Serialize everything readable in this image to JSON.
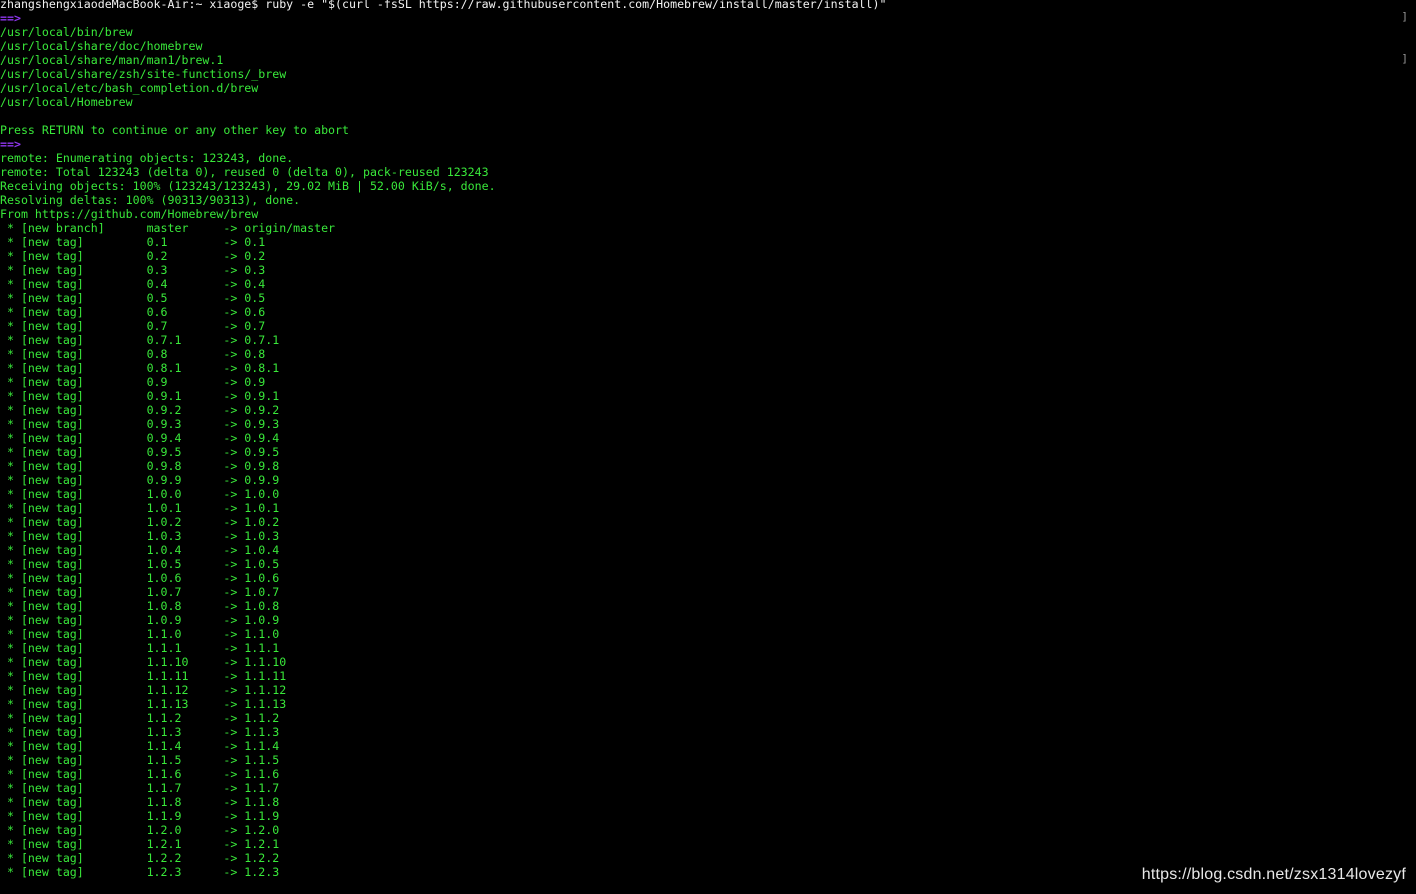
{
  "terminal": {
    "lines": [
      {
        "type": "prompt",
        "text": "zhangshengxiaodeMacBook-Air:~ xiaoge$ ruby -e \"$(curl -fsSL https://raw.githubusercontent.com/Homebrew/install/master/install)\""
      },
      {
        "type": "arrow",
        "text": "==>"
      },
      {
        "type": "info",
        "text": "/usr/local/bin/brew"
      },
      {
        "type": "info",
        "text": "/usr/local/share/doc/homebrew"
      },
      {
        "type": "info",
        "text": "/usr/local/share/man/man1/brew.1"
      },
      {
        "type": "info",
        "text": "/usr/local/share/zsh/site-functions/_brew"
      },
      {
        "type": "info",
        "text": "/usr/local/etc/bash_completion.d/brew"
      },
      {
        "type": "info",
        "text": "/usr/local/Homebrew"
      },
      {
        "type": "blank",
        "text": ""
      },
      {
        "type": "info",
        "text": "Press RETURN to continue or any other key to abort"
      },
      {
        "type": "arrow",
        "text": "==>"
      },
      {
        "type": "info",
        "text": "remote: Enumerating objects: 123243, done."
      },
      {
        "type": "info",
        "text": "remote: Total 123243 (delta 0), reused 0 (delta 0), pack-reused 123243"
      },
      {
        "type": "info",
        "text": "Receiving objects: 100% (123243/123243), 29.02 MiB | 52.00 KiB/s, done."
      },
      {
        "type": "info",
        "text": "Resolving deltas: 100% (90313/90313), done."
      },
      {
        "type": "info",
        "text": "From https://github.com/Homebrew/brew"
      },
      {
        "type": "info",
        "text": " * [new branch]      master     -> origin/master"
      },
      {
        "type": "info",
        "text": " * [new tag]         0.1        -> 0.1"
      },
      {
        "type": "info",
        "text": " * [new tag]         0.2        -> 0.2"
      },
      {
        "type": "info",
        "text": " * [new tag]         0.3        -> 0.3"
      },
      {
        "type": "info",
        "text": " * [new tag]         0.4        -> 0.4"
      },
      {
        "type": "info",
        "text": " * [new tag]         0.5        -> 0.5"
      },
      {
        "type": "info",
        "text": " * [new tag]         0.6        -> 0.6"
      },
      {
        "type": "info",
        "text": " * [new tag]         0.7        -> 0.7"
      },
      {
        "type": "info",
        "text": " * [new tag]         0.7.1      -> 0.7.1"
      },
      {
        "type": "info",
        "text": " * [new tag]         0.8        -> 0.8"
      },
      {
        "type": "info",
        "text": " * [new tag]         0.8.1      -> 0.8.1"
      },
      {
        "type": "info",
        "text": " * [new tag]         0.9        -> 0.9"
      },
      {
        "type": "info",
        "text": " * [new tag]         0.9.1      -> 0.9.1"
      },
      {
        "type": "info",
        "text": " * [new tag]         0.9.2      -> 0.9.2"
      },
      {
        "type": "info",
        "text": " * [new tag]         0.9.3      -> 0.9.3"
      },
      {
        "type": "info",
        "text": " * [new tag]         0.9.4      -> 0.9.4"
      },
      {
        "type": "info",
        "text": " * [new tag]         0.9.5      -> 0.9.5"
      },
      {
        "type": "info",
        "text": " * [new tag]         0.9.8      -> 0.9.8"
      },
      {
        "type": "info",
        "text": " * [new tag]         0.9.9      -> 0.9.9"
      },
      {
        "type": "info",
        "text": " * [new tag]         1.0.0      -> 1.0.0"
      },
      {
        "type": "info",
        "text": " * [new tag]         1.0.1      -> 1.0.1"
      },
      {
        "type": "info",
        "text": " * [new tag]         1.0.2      -> 1.0.2"
      },
      {
        "type": "info",
        "text": " * [new tag]         1.0.3      -> 1.0.3"
      },
      {
        "type": "info",
        "text": " * [new tag]         1.0.4      -> 1.0.4"
      },
      {
        "type": "info",
        "text": " * [new tag]         1.0.5      -> 1.0.5"
      },
      {
        "type": "info",
        "text": " * [new tag]         1.0.6      -> 1.0.6"
      },
      {
        "type": "info",
        "text": " * [new tag]         1.0.7      -> 1.0.7"
      },
      {
        "type": "info",
        "text": " * [new tag]         1.0.8      -> 1.0.8"
      },
      {
        "type": "info",
        "text": " * [new tag]         1.0.9      -> 1.0.9"
      },
      {
        "type": "info",
        "text": " * [new tag]         1.1.0      -> 1.1.0"
      },
      {
        "type": "info",
        "text": " * [new tag]         1.1.1      -> 1.1.1"
      },
      {
        "type": "info",
        "text": " * [new tag]         1.1.10     -> 1.1.10"
      },
      {
        "type": "info",
        "text": " * [new tag]         1.1.11     -> 1.1.11"
      },
      {
        "type": "info",
        "text": " * [new tag]         1.1.12     -> 1.1.12"
      },
      {
        "type": "info",
        "text": " * [new tag]         1.1.13     -> 1.1.13"
      },
      {
        "type": "info",
        "text": " * [new tag]         1.1.2      -> 1.1.2"
      },
      {
        "type": "info",
        "text": " * [new tag]         1.1.3      -> 1.1.3"
      },
      {
        "type": "info",
        "text": " * [new tag]         1.1.4      -> 1.1.4"
      },
      {
        "type": "info",
        "text": " * [new tag]         1.1.5      -> 1.1.5"
      },
      {
        "type": "info",
        "text": " * [new tag]         1.1.6      -> 1.1.6"
      },
      {
        "type": "info",
        "text": " * [new tag]         1.1.7      -> 1.1.7"
      },
      {
        "type": "info",
        "text": " * [new tag]         1.1.8      -> 1.1.8"
      },
      {
        "type": "info",
        "text": " * [new tag]         1.1.9      -> 1.1.9"
      },
      {
        "type": "info",
        "text": " * [new tag]         1.2.0      -> 1.2.0"
      },
      {
        "type": "info",
        "text": " * [new tag]         1.2.1      -> 1.2.1"
      },
      {
        "type": "info",
        "text": " * [new tag]         1.2.2      -> 1.2.2"
      },
      {
        "type": "info",
        "text": " * [new tag]         1.2.3      -> 1.2.3"
      }
    ],
    "edge_brackets": [
      "]",
      "]"
    ]
  },
  "watermark": "https://blog.csdn.net/zsx1314lovezyf",
  "colors": {
    "background": "#000000",
    "output_text": "#39e83a",
    "prompt_text": "#f2f2f2",
    "arrow_marker": "#8f36f0"
  }
}
